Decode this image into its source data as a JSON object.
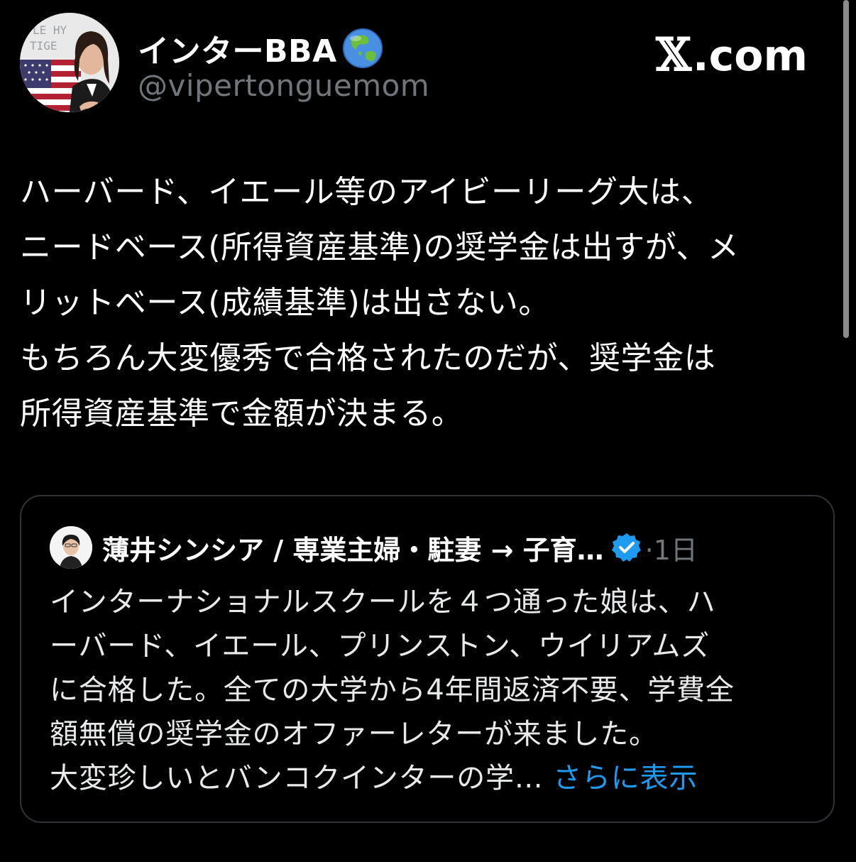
{
  "author": {
    "display_name": "インターBBA",
    "name_emoji": "globe-asia-australia-icon",
    "handle": "@vipertonguemom",
    "avatar_sign_text": "LE HY\nTIGE"
  },
  "brand": {
    "x_letter": "𝕏",
    "domain": ".com"
  },
  "tweet": {
    "text": "ハーバード、イエール等のアイビーリーグ大は、\nニードベース(所得資産基準)の奨学金は出すが、メ\nリットベース(成績基準)は出さない。\nもちろん大変優秀で合格されたのだが、奨学金は\n所得資産基準で金額が決まる。"
  },
  "quote": {
    "author_name": "薄井シンシア / 専業主婦・駐妻 → 子育…",
    "verified": true,
    "time": "·1日",
    "text": "インターナショナルスクールを４つ通った娘は、ハ\nーバード、イエール、プリンストン、ウイリアムズ\nに合格した。全ての大学から4年間返済不要、学費全\n額無償の奨学金のオファーレターが来ました。\n大変珍しいとバンコクインターの学… ",
    "show_more": "さらに表示"
  },
  "colors": {
    "background": "#000000",
    "text_primary": "#ffffff",
    "text_secondary": "#71767b",
    "link": "#1d9bf0",
    "border": "#2f3336",
    "verified": "#1d9bf0"
  }
}
